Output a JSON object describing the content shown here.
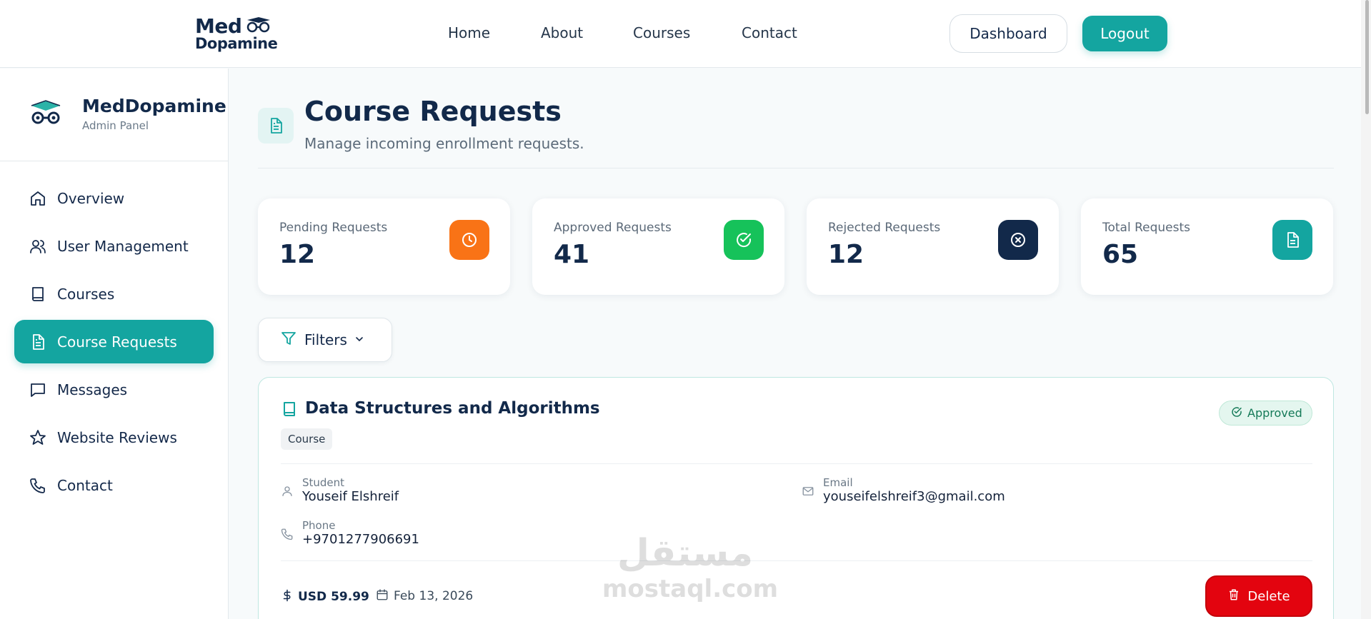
{
  "topnav": {
    "logo_line1": "Med",
    "logo_line2": "Dopamine",
    "links": [
      "Home",
      "About",
      "Courses",
      "Contact"
    ],
    "dashboard_label": "Dashboard",
    "logout_label": "Logout"
  },
  "sidebar": {
    "brand": "MedDopamine",
    "subtitle": "Admin Panel",
    "items": [
      {
        "label": "Overview",
        "icon": "home-icon"
      },
      {
        "label": "User Management",
        "icon": "users-icon"
      },
      {
        "label": "Courses",
        "icon": "book-icon"
      },
      {
        "label": "Course Requests",
        "icon": "document-icon",
        "active": true
      },
      {
        "label": "Messages",
        "icon": "message-icon"
      },
      {
        "label": "Website Reviews",
        "icon": "star-icon"
      },
      {
        "label": "Contact",
        "icon": "phone-icon"
      }
    ]
  },
  "page": {
    "title": "Course Requests",
    "subtitle": "Manage incoming enrollment requests."
  },
  "stats": [
    {
      "label": "Pending Requests",
      "value": "12",
      "icon": "clock-icon",
      "color": "#f97316"
    },
    {
      "label": "Approved Requests",
      "value": "41",
      "icon": "check-circle-icon",
      "color": "#16c25a"
    },
    {
      "label": "Rejected Requests",
      "value": "12",
      "icon": "x-circle-icon",
      "color": "#12294a"
    },
    {
      "label": "Total Requests",
      "value": "65",
      "icon": "document-icon",
      "color": "#14a5a0"
    }
  ],
  "filters": {
    "label": "Filters"
  },
  "request": {
    "course_title": "Data Structures and Algorithms",
    "type_tag": "Course",
    "status": "Approved",
    "student_label": "Student",
    "student": "Youseif Elshreif",
    "email_label": "Email",
    "email": "youseifelshreif3@gmail.com",
    "phone_label": "Phone",
    "phone": "+9701277906691",
    "price": "USD 59.99",
    "date": "Feb 13, 2026",
    "delete_label": "Delete"
  },
  "watermark": {
    "line1": "مستقل",
    "line2": "mostaql.com"
  },
  "colors": {
    "accent": "#14a5a0",
    "navy": "#12294a",
    "danger": "#e3040f"
  }
}
